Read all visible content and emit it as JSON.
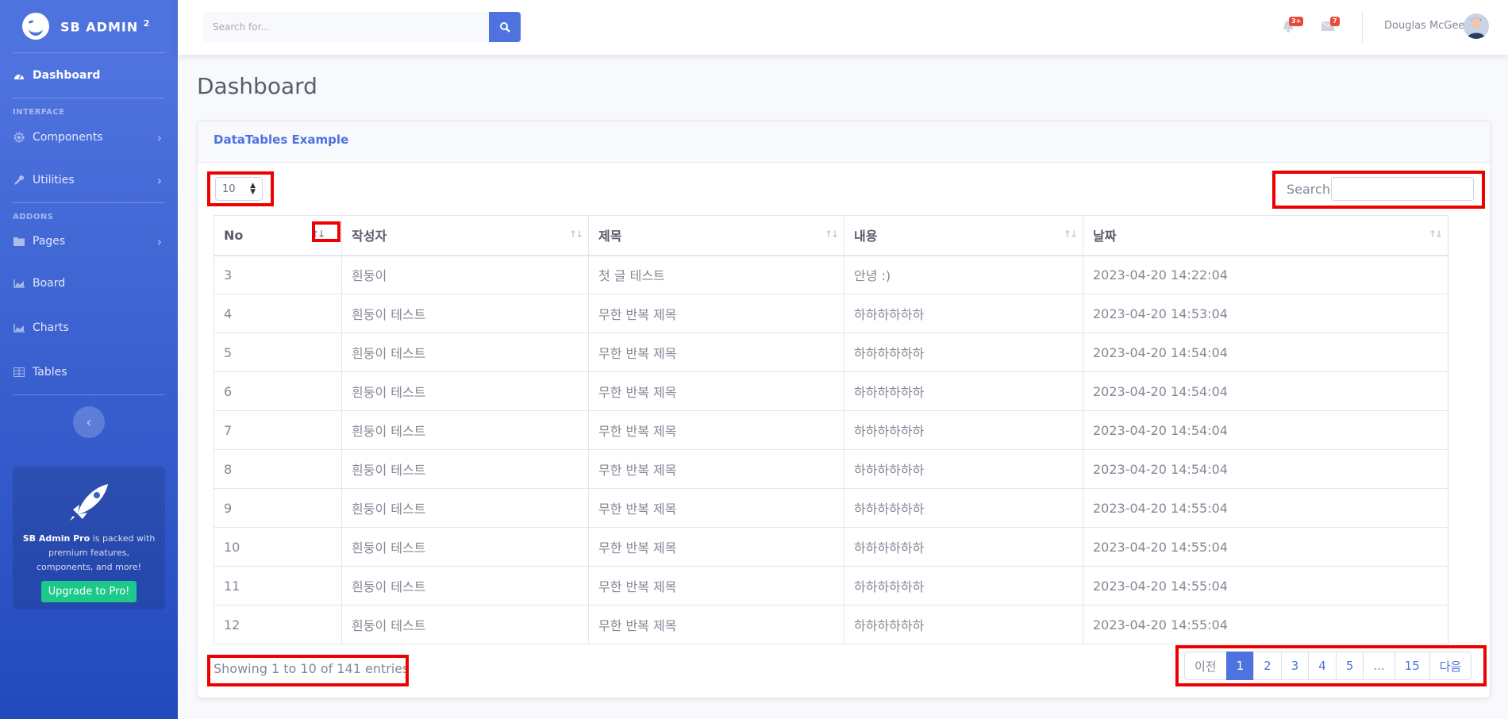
{
  "sidebar": {
    "brand": "SB ADMIN",
    "brand_sup": "2",
    "dashboard": "Dashboard",
    "heading_interface": "INTERFACE",
    "components": "Components",
    "utilities": "Utilities",
    "heading_addons": "ADDONS",
    "pages": "Pages",
    "board": "Board",
    "charts": "Charts",
    "tables": "Tables",
    "promo_bold": "SB Admin Pro",
    "promo_text": " is packed with premium features, components, and more!",
    "promo_button": "Upgrade to Pro!"
  },
  "topbar": {
    "search_placeholder": "Search for...",
    "alerts_badge": "3+",
    "messages_badge": "7",
    "user_name": "Douglas McGee"
  },
  "page_title": "Dashboard",
  "card": {
    "title": "DataTables Example",
    "length_value": "10",
    "search_label": "Search",
    "columns": [
      "No",
      "작성자",
      "제목",
      "내용",
      "날짜"
    ],
    "rows": [
      [
        "3",
        "흰둥이",
        "첫 글 테스트",
        "안녕 :)",
        "2023-04-20 14:22:04"
      ],
      [
        "4",
        "흰둥이 테스트",
        "무한 반복 제목",
        "하하하하하하",
        "2023-04-20 14:53:04"
      ],
      [
        "5",
        "흰둥이 테스트",
        "무한 반복 제목",
        "하하하하하하",
        "2023-04-20 14:54:04"
      ],
      [
        "6",
        "흰둥이 테스트",
        "무한 반복 제목",
        "하하하하하하",
        "2023-04-20 14:54:04"
      ],
      [
        "7",
        "흰둥이 테스트",
        "무한 반복 제목",
        "하하하하하하",
        "2023-04-20 14:54:04"
      ],
      [
        "8",
        "흰둥이 테스트",
        "무한 반복 제목",
        "하하하하하하",
        "2023-04-20 14:54:04"
      ],
      [
        "9",
        "흰둥이 테스트",
        "무한 반복 제목",
        "하하하하하하",
        "2023-04-20 14:55:04"
      ],
      [
        "10",
        "흰둥이 테스트",
        "무한 반복 제목",
        "하하하하하하",
        "2023-04-20 14:55:04"
      ],
      [
        "11",
        "흰둥이 테스트",
        "무한 반복 제목",
        "하하하하하하",
        "2023-04-20 14:55:04"
      ],
      [
        "12",
        "흰둥이 테스트",
        "무한 반복 제목",
        "하하하하하하",
        "2023-04-20 14:55:04"
      ]
    ],
    "info": "Showing 1 to 10 of 141 entries",
    "pagination": [
      "이전",
      "1",
      "2",
      "3",
      "4",
      "5",
      "...",
      "15",
      "다음"
    ]
  },
  "colors": {
    "primary": "#4e73df",
    "success": "#1cc88a",
    "danger": "#e74a3b",
    "highlight": "#e00000"
  }
}
